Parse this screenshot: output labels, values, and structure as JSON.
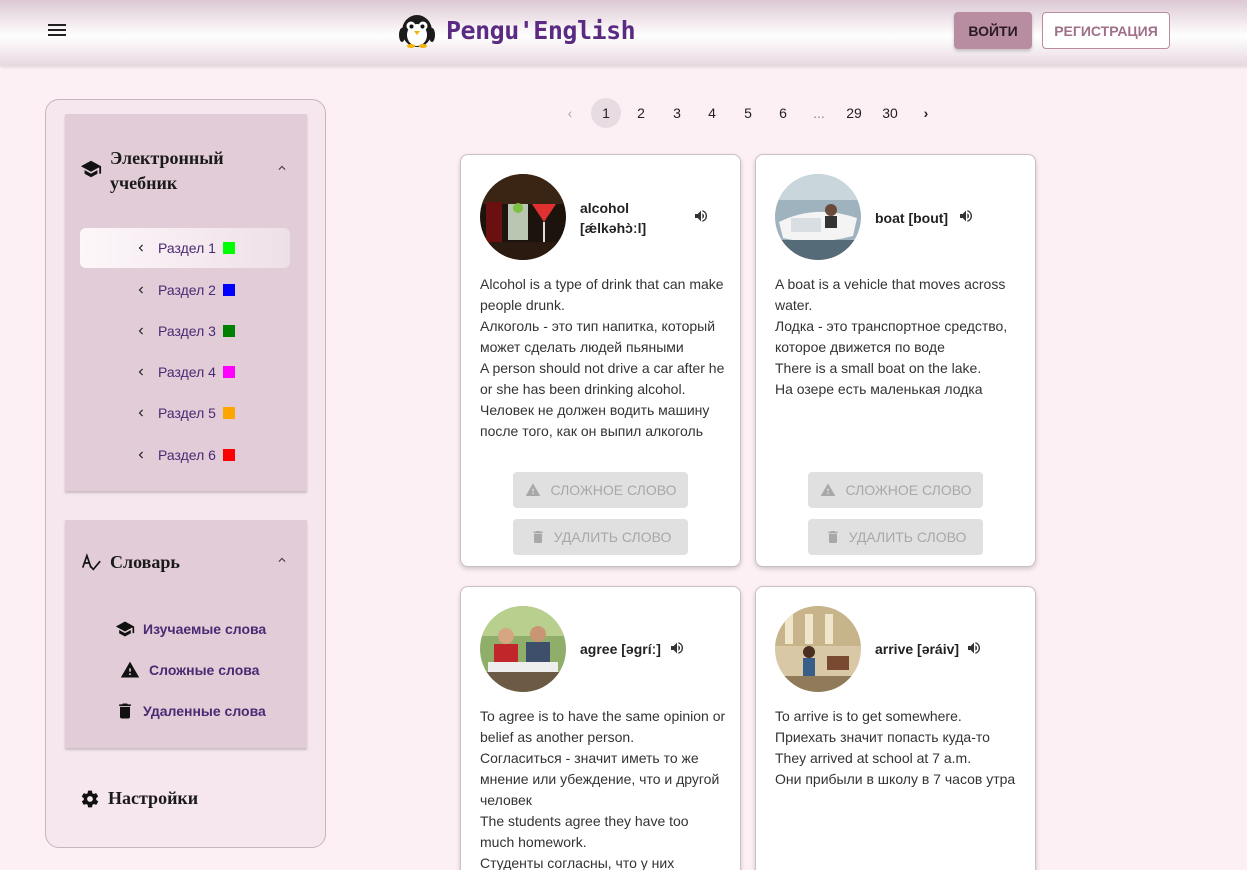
{
  "header": {
    "menu_icon": "hamburger-icon",
    "logo_text": "Pengu'English",
    "login_label": "ВОЙТИ",
    "register_label": "РЕГИСТРАЦИЯ"
  },
  "sidebar": {
    "textbook": {
      "title_line1": "Электронный",
      "title_line2": "учебник",
      "icon": "graduation-cap-icon",
      "sections": [
        {
          "label": "Раздел 1",
          "color": "#00ff00"
        },
        {
          "label": "Раздел 2",
          "color": "#0000ff"
        },
        {
          "label": "Раздел 3",
          "color": "#008000"
        },
        {
          "label": "Раздел 4",
          "color": "#ff00ff"
        },
        {
          "label": "Раздел 5",
          "color": "#ffa500"
        },
        {
          "label": "Раздел 6",
          "color": "#ff0000"
        }
      ]
    },
    "dictionary": {
      "title": "Словарь",
      "icon": "spellcheck-icon",
      "items": [
        {
          "label": "Изучаемые слова",
          "icon": "graduation-cap-icon"
        },
        {
          "label": "Сложные слова",
          "icon": "warning-icon"
        },
        {
          "label": "Удаленные слова",
          "icon": "trash-icon"
        }
      ]
    },
    "settings": {
      "label": "Настройки",
      "icon": "gear-icon"
    }
  },
  "pagination": {
    "prev": "‹",
    "next": "›",
    "pages": [
      "1",
      "2",
      "3",
      "4",
      "5",
      "6",
      "...",
      "29",
      "30"
    ],
    "current": "1"
  },
  "cards": [
    {
      "word_line1": "alcohol",
      "word_line2": "[ǽlkəhɔ̀ːl]",
      "lines": [
        "Alcohol is a type of drink that can make people drunk.",
        "Алкоголь - это тип напитка, который может сделать людей пьяными",
        "A person should not drive a car after he or she has been drinking alcohol.",
        "Человек не должен водить машину после того, как он выпил алкоголь"
      ],
      "hard_label": "СЛОЖНОЕ СЛОВО",
      "delete_label": "УДАЛИТЬ СЛОВО"
    },
    {
      "word_line1": "boat [bout]",
      "word_line2": "",
      "lines": [
        "A boat is a vehicle that moves across water.",
        "Лодка - это транспортное средство, которое движется по воде",
        "There is a small boat on the lake.",
        "На озере есть маленькая лодка"
      ],
      "hard_label": "СЛОЖНОЕ СЛОВО",
      "delete_label": "УДАЛИТЬ СЛОВО"
    },
    {
      "word_line1": "agree [əgríː]",
      "word_line2": "",
      "lines": [
        "To agree is to have the same opinion or belief as another person.",
        "Согласиться - значит иметь то же мнение или убеждение, что и другой человек",
        "The students agree they have too much homework.",
        "Студенты согласны, что у них"
      ]
    },
    {
      "word_line1": "arrive [əráiv]",
      "word_line2": "",
      "lines": [
        "To arrive is to get somewhere.",
        "Приехать значит попасть куда-то",
        "They arrived at school at 7 a.m.",
        "Они прибыли в школу в 7 часов утра"
      ]
    }
  ]
}
